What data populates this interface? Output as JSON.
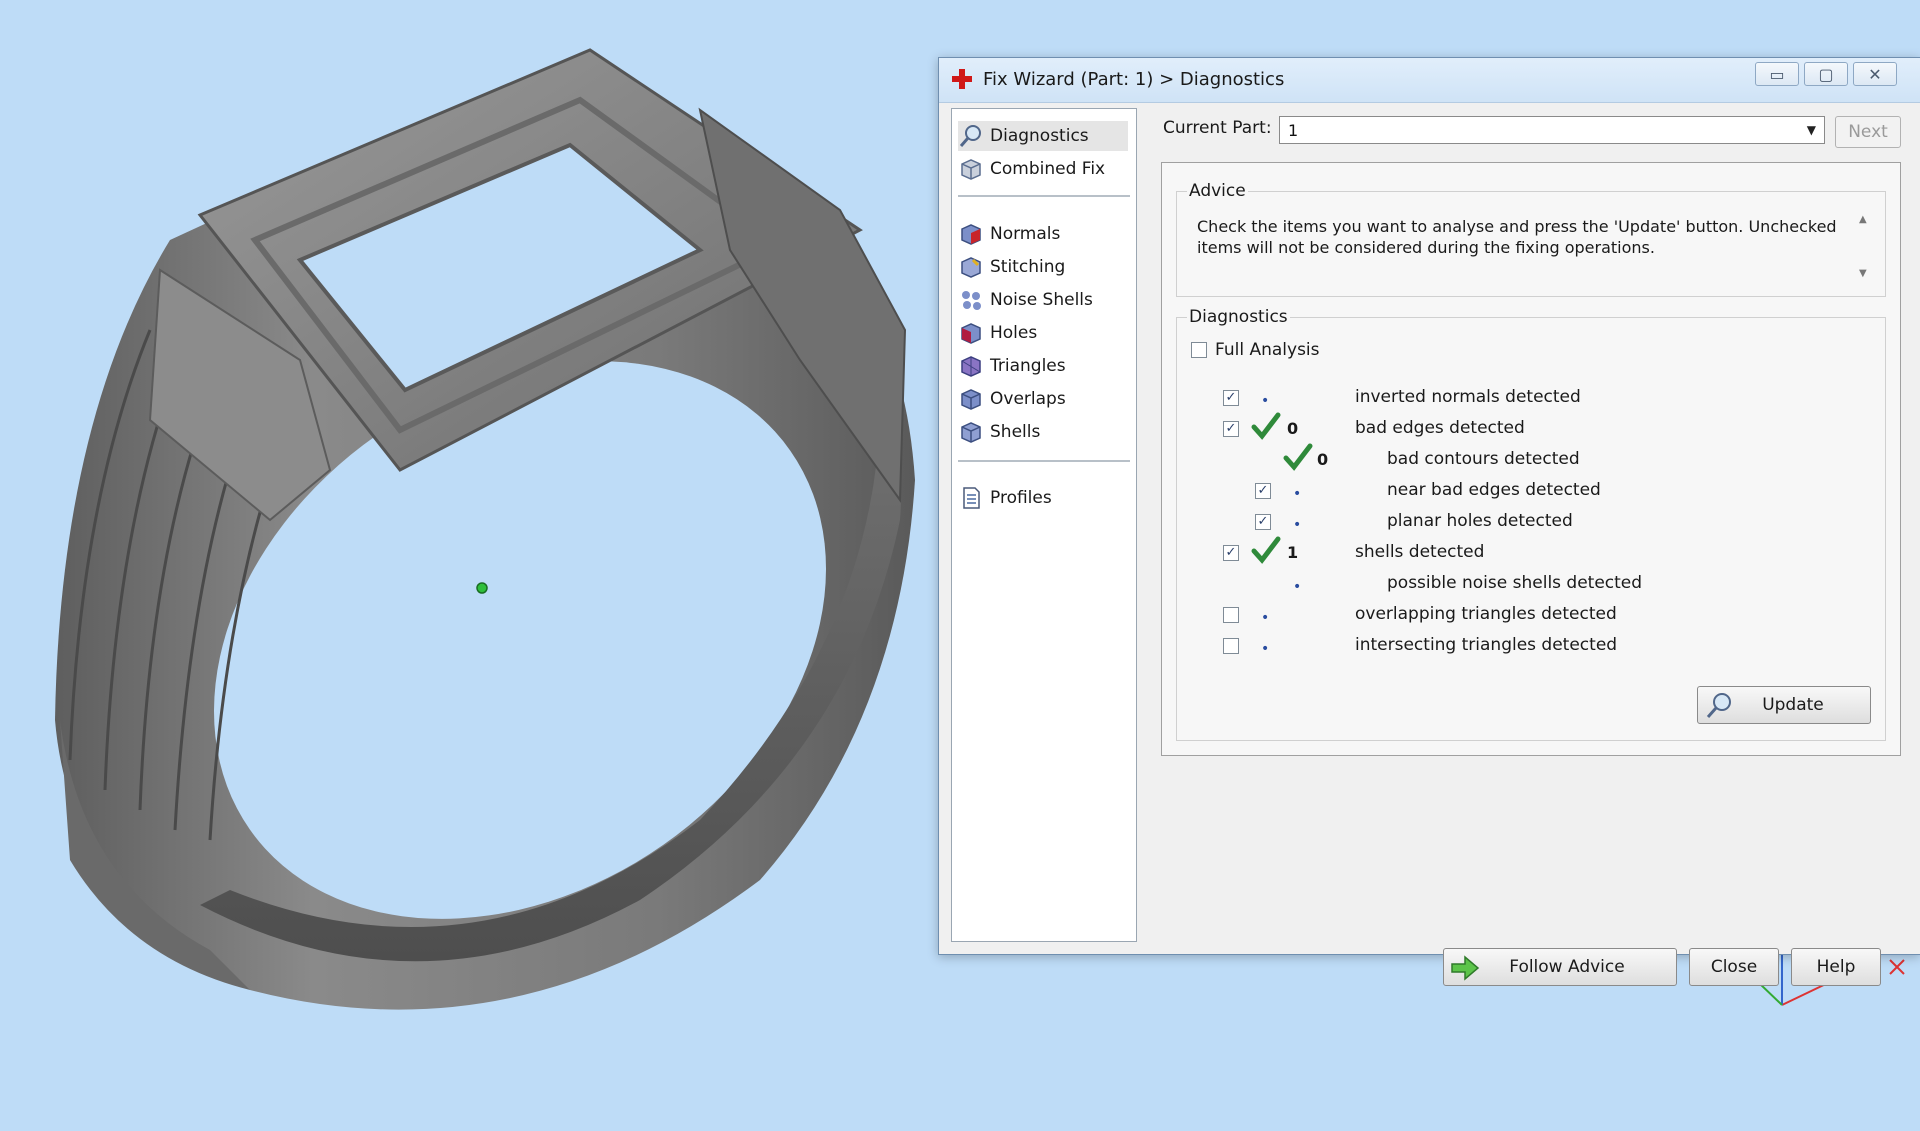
{
  "dialog": {
    "title": "Fix Wizard (Part: 1) > Diagnostics",
    "window_buttons": {
      "minimize": "▭",
      "maximize": "▢",
      "close": "✕"
    }
  },
  "nav": {
    "top_items": [
      {
        "label": "Diagnostics",
        "icon": "magnifier-icon",
        "selected": true
      },
      {
        "label": "Combined Fix",
        "icon": "cube-icon"
      }
    ],
    "mid_items": [
      {
        "label": "Normals",
        "icon": "cube-red-face-icon"
      },
      {
        "label": "Stitching",
        "icon": "cube-stitch-icon"
      },
      {
        "label": "Noise Shells",
        "icon": "noise-shells-icon"
      },
      {
        "label": "Holes",
        "icon": "cube-holes-icon"
      },
      {
        "label": "Triangles",
        "icon": "cube-triangles-icon"
      },
      {
        "label": "Overlaps",
        "icon": "cube-overlaps-icon"
      },
      {
        "label": "Shells",
        "icon": "cube-shells-icon"
      }
    ],
    "bottom_items": [
      {
        "label": "Profiles",
        "icon": "document-icon"
      }
    ]
  },
  "current_part": {
    "label": "Current Part:",
    "value": "1",
    "next_label": "Next"
  },
  "advice": {
    "title": "Advice",
    "text": "Check the items you want to analyse and press the 'Update' button. Unchecked items will not be considered during the fixing operations."
  },
  "diagnostics": {
    "title": "Diagnostics",
    "full_analysis_label": "Full Analysis",
    "full_analysis_checked": false,
    "rows": [
      {
        "label": "inverted normals detected",
        "checked": true,
        "status": "•",
        "count": ""
      },
      {
        "label": "bad edges detected",
        "checked": true,
        "status": "ok",
        "count": "0"
      },
      {
        "label": "bad contours detected",
        "checked": null,
        "status": "ok",
        "count": "0"
      },
      {
        "label": "near bad edges detected",
        "checked": true,
        "status": "•",
        "count": ""
      },
      {
        "label": "planar holes detected",
        "checked": true,
        "status": "•",
        "count": ""
      },
      {
        "label": "shells detected",
        "checked": true,
        "status": "ok",
        "count": "1"
      },
      {
        "label": "possible noise shells detected",
        "checked": null,
        "status": "•",
        "count": ""
      },
      {
        "label": "overlapping triangles detected",
        "checked": false,
        "status": "•",
        "count": ""
      },
      {
        "label": "intersecting triangles detected",
        "checked": false,
        "status": "•",
        "count": ""
      }
    ],
    "update_label": "Update"
  },
  "footer": {
    "follow_advice_label": "Follow Advice",
    "close_label": "Close",
    "help_label": "Help"
  },
  "colors": {
    "background": "#bedcf7",
    "ring": "#7a7a7a",
    "check_green": "#2f8a3a",
    "cube_blue": "#7c8fc9"
  }
}
